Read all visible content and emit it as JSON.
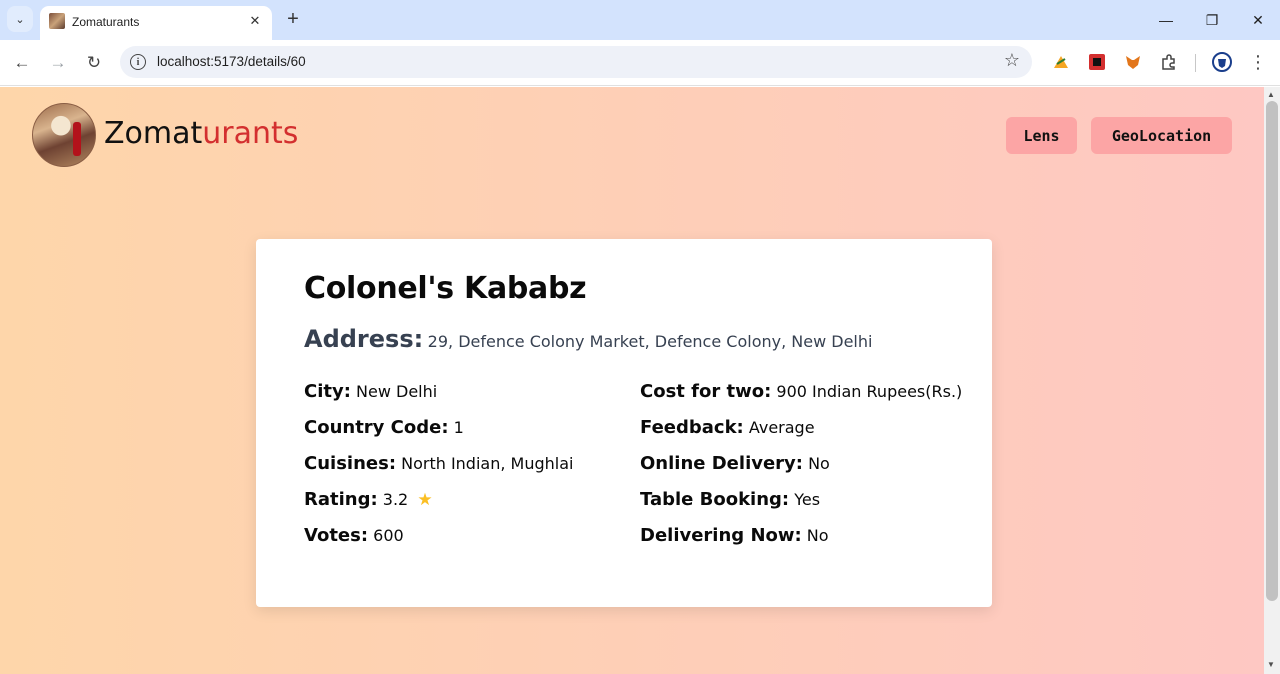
{
  "browser": {
    "tab_title": "Zomaturants",
    "url": "localhost:5173/details/60"
  },
  "page": {
    "brand_main": "Zomat",
    "brand_accent": "urants",
    "accent_color": "#d32f2f",
    "nav": [
      "Lens",
      "GeoLocation"
    ],
    "restaurant": {
      "name": "Colonel's Kababz",
      "address_label": "Address:",
      "address": "29, Defence Colony Market, Defence Colony, New Delhi",
      "left_fields": [
        {
          "label": "City:",
          "value": "New Delhi"
        },
        {
          "label": "Country Code:",
          "value": "1"
        },
        {
          "label": "Cuisines:",
          "value": "North Indian, Mughlai"
        },
        {
          "label": "Rating:",
          "value": "3.2"
        },
        {
          "label": "Votes:",
          "value": "600"
        }
      ],
      "right_fields": [
        {
          "label": "Cost for two:",
          "value": "900 Indian Rupees(Rs.)"
        },
        {
          "label": "Feedback:",
          "value": "Average"
        },
        {
          "label": "Online Delivery:",
          "value": "No"
        },
        {
          "label": "Table Booking:",
          "value": "Yes"
        },
        {
          "label": "Delivering Now:",
          "value": "No"
        }
      ],
      "rating_icon": "star-icon"
    }
  }
}
